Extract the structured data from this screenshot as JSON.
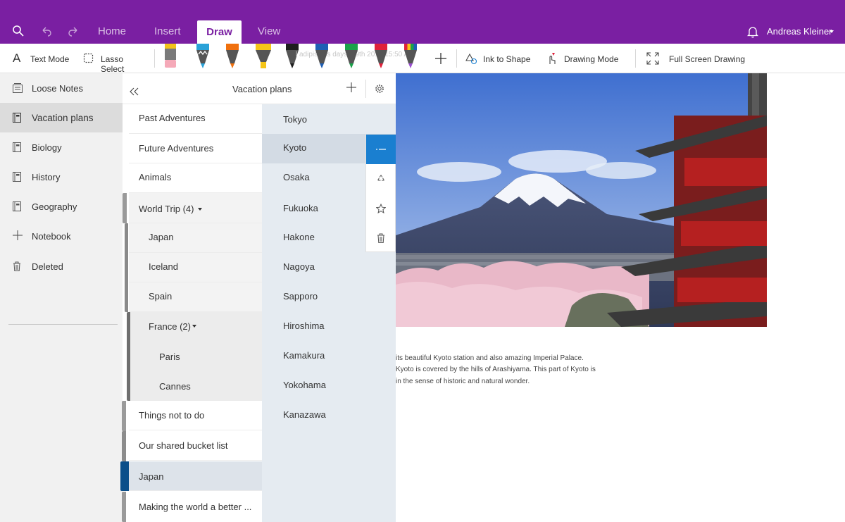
{
  "ribbon": {
    "tabs": [
      "Home",
      "Insert",
      "Draw",
      "View"
    ],
    "active_tab": "Draw",
    "user_name": "Andreas Kleiner",
    "accent_color": "#7a1fa2"
  },
  "toolbar": {
    "text_mode": "Text Mode",
    "lasso_select": "Lasso Select",
    "ink_to_shape": "Ink to Shape",
    "drawing_mode": "Drawing Mode",
    "full_screen_drawing": "Full Screen Drawing",
    "pen_colors": [
      "#2aa2d8",
      "#f0700e",
      "#f5c518",
      "#1e1e1e",
      "#1e5fb4",
      "#1aa24a",
      "#e0203a",
      "rainbow"
    ]
  },
  "notebooks": {
    "items": [
      {
        "label": "Loose Notes",
        "icon": "notes-stack-icon"
      },
      {
        "label": "Vacation plans",
        "icon": "notebook-icon"
      },
      {
        "label": "Biology",
        "icon": "notebook-icon"
      },
      {
        "label": "History",
        "icon": "notebook-icon"
      },
      {
        "label": "Geography",
        "icon": "notebook-icon"
      },
      {
        "label": "Notebook",
        "icon": "plus-icon"
      },
      {
        "label": "Deleted",
        "icon": "trash-icon"
      }
    ],
    "selected": "Vacation plans"
  },
  "sections": {
    "header_title": "Vacation plans",
    "items": [
      {
        "label": "Past Adventures"
      },
      {
        "label": "Future Adventures"
      },
      {
        "label": "Animals"
      },
      {
        "label": "World Trip (4)"
      },
      {
        "label": "Japan"
      },
      {
        "label": "Iceland"
      },
      {
        "label": "Spain"
      },
      {
        "label": "France (2)"
      },
      {
        "label": "Paris"
      },
      {
        "label": "Cannes"
      },
      {
        "label": "Things not to do"
      },
      {
        "label": "Our shared bucket list"
      },
      {
        "label": "Japan"
      },
      {
        "label": "Making the world a better ..."
      }
    ],
    "selected_color": "#0b4f8a"
  },
  "pages": {
    "items": [
      "Tokyo",
      "Kyoto",
      "Osaka",
      "Fukuoka",
      "Hakone",
      "Nagoya",
      "Sapporo",
      "Hiroshima",
      "Kamakura",
      "Yokohama",
      "Kanazawa"
    ],
    "selected": "Kyoto",
    "action_color": "#1a7fd0"
  },
  "canvas": {
    "note_lines": [
      "its beautiful Kyoto station and also amazing Imperial Palace.",
      "Kyoto is covered by the hills of Arashiyama. This part of Kyoto is",
      "in the sense of historic and natural wonder."
    ]
  }
}
